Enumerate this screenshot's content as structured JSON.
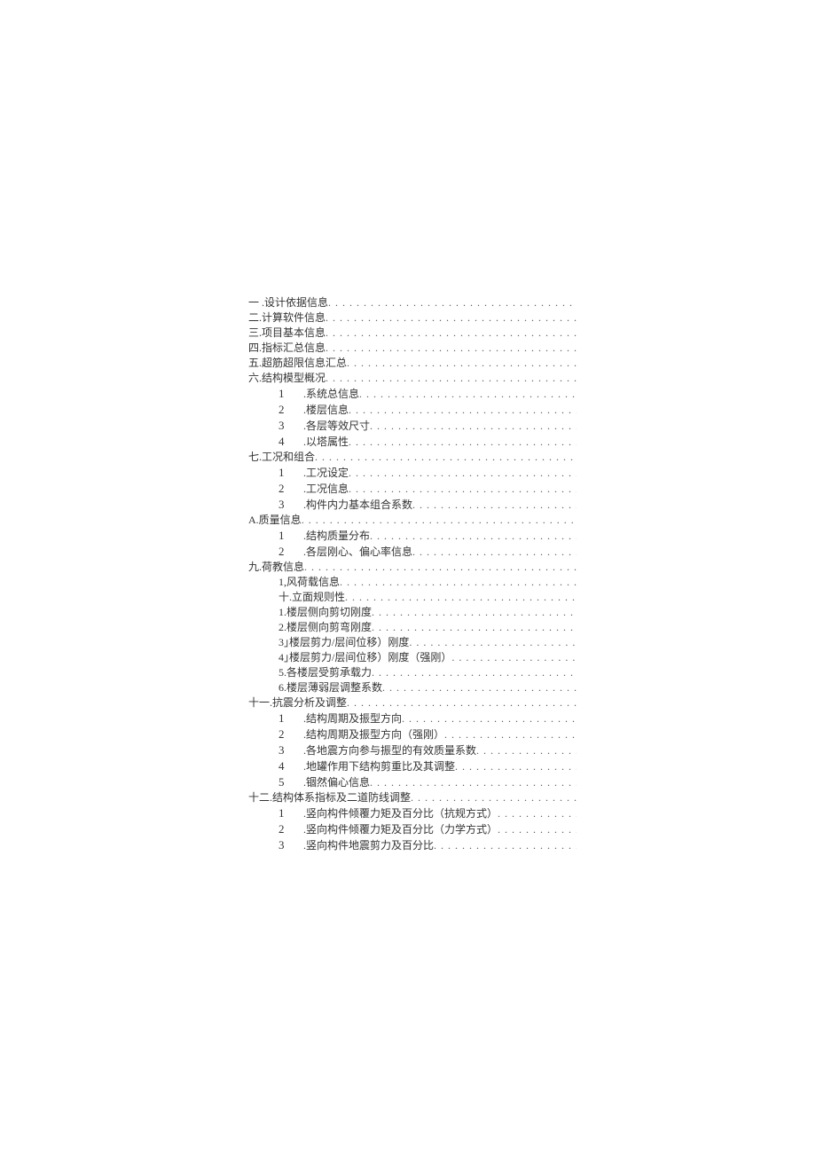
{
  "toc": [
    {
      "level": 0,
      "prefix": "一 .",
      "text": "设计依据信息"
    },
    {
      "level": 0,
      "prefix": "二.",
      "text": "计算软件信息"
    },
    {
      "level": 0,
      "prefix": "三.",
      "text": "项目基本信息"
    },
    {
      "level": 0,
      "prefix": "四.",
      "text": "指标汇总信息"
    },
    {
      "level": 0,
      "prefix": "五.",
      "text": "超筋超限信息汇总"
    },
    {
      "level": 0,
      "prefix": "六.",
      "text": "结构模型概况"
    },
    {
      "level": 1,
      "prefix": "1",
      "text": ".系统总信息"
    },
    {
      "level": 1,
      "prefix": "2",
      "text": ".楼层信息"
    },
    {
      "level": 1,
      "prefix": "3",
      "text": ".各层等效尺寸"
    },
    {
      "level": 1,
      "prefix": "4",
      "text": ".以塔属性"
    },
    {
      "level": 0,
      "prefix": "七.",
      "text": "工况和组合"
    },
    {
      "level": 1,
      "prefix": "1",
      "text": ".工况设定"
    },
    {
      "level": 1,
      "prefix": "2",
      "text": ".工况信息"
    },
    {
      "level": 1,
      "prefix": "3",
      "text": ".构件内力基本组合系数"
    },
    {
      "level": 0,
      "prefix": "A.",
      "text": "质量信息"
    },
    {
      "level": 1,
      "prefix": "1",
      "text": ".结构质量分布"
    },
    {
      "level": 1,
      "prefix": "2",
      "text": ".各层刚心、偏心率信息"
    },
    {
      "level": 0,
      "prefix": "九.",
      "text": "荷教信息"
    },
    {
      "level": 2,
      "prefix": "1,",
      "text": "风荷载信息"
    },
    {
      "level": 2,
      "prefix": "十.",
      "text": "立面规则性"
    },
    {
      "level": 2,
      "prefix": "1.",
      "text": "楼层侧向剪切刚度"
    },
    {
      "level": 2,
      "prefix": "2.",
      "text": "楼层侧向剪弯刚度"
    },
    {
      "level": 2,
      "prefix": "3｣",
      "text": "楼层剪力/层间位移）刚度"
    },
    {
      "level": 2,
      "prefix": "4｣",
      "text": "楼层剪力/层间位移）刚度（强刚）"
    },
    {
      "level": 2,
      "prefix": "5.",
      "text": "各楼层受剪承载力"
    },
    {
      "level": 2,
      "prefix": "6.",
      "text": "楼层薄弱层调整系数"
    },
    {
      "level": 0,
      "prefix": "十一.",
      "text": "抗震分析及调整"
    },
    {
      "level": 1,
      "prefix": "1",
      "text": ".结构周期及振型方向"
    },
    {
      "level": 1,
      "prefix": "2",
      "text": ".结构周期及振型方向（强刚）"
    },
    {
      "level": 1,
      "prefix": "3",
      "text": ".各地震方向参与振型的有效质量系数"
    },
    {
      "level": 1,
      "prefix": "4",
      "text": ".地罐作用下结构剪重比及其调整"
    },
    {
      "level": 1,
      "prefix": "5",
      "text": ".锢然偏心信息"
    },
    {
      "level": 0,
      "prefix": "十二.",
      "text": "结构体系指标及二道防线调整"
    },
    {
      "level": 1,
      "prefix": "1",
      "text": ".竖向构件倾覆力矩及百分比（抗规方式）"
    },
    {
      "level": 1,
      "prefix": "2",
      "text": ".竖向构件倾覆力矩及百分比（力学方式）"
    },
    {
      "level": 1,
      "prefix": "3",
      "text": ".竖向构件地震剪力及百分比"
    }
  ]
}
